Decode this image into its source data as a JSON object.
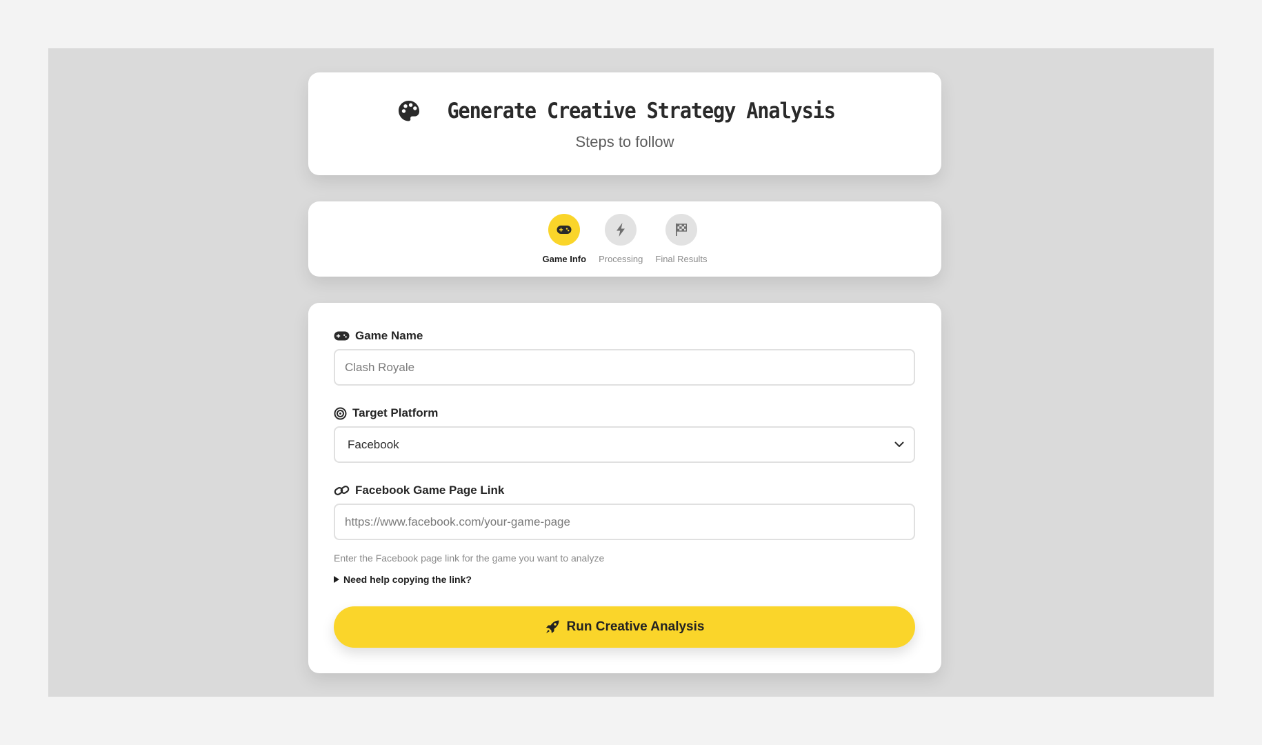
{
  "header": {
    "title": "Generate Creative Strategy Analysis",
    "subtitle": "Steps to follow",
    "icon": "palette-icon"
  },
  "steps": [
    {
      "label": "Game Info",
      "icon": "gamepad-icon",
      "active": true
    },
    {
      "label": "Processing",
      "icon": "bolt-icon",
      "active": false
    },
    {
      "label": "Final Results",
      "icon": "flag-checkered-icon",
      "active": false
    }
  ],
  "form": {
    "game_name": {
      "label": "Game Name",
      "icon": "gamepad-icon",
      "placeholder": "Clash Royale",
      "value": ""
    },
    "platform": {
      "label": "Target Platform",
      "icon": "target-icon",
      "selected": "Facebook"
    },
    "page_link": {
      "label": "Facebook Game Page Link",
      "icon": "link-icon",
      "placeholder": "https://www.facebook.com/your-game-page",
      "value": "",
      "helper": "Enter the Facebook page link for the game you want to analyze"
    },
    "help_toggle": "Need help copying the link?",
    "submit_label": "Run Creative Analysis",
    "submit_icon": "rocket-icon"
  },
  "colors": {
    "accent": "#fad52a",
    "page_background": "#f3f3f3",
    "frame_background": "#dadada",
    "card_background": "#ffffff",
    "inactive_step": "#e2e2e2"
  }
}
